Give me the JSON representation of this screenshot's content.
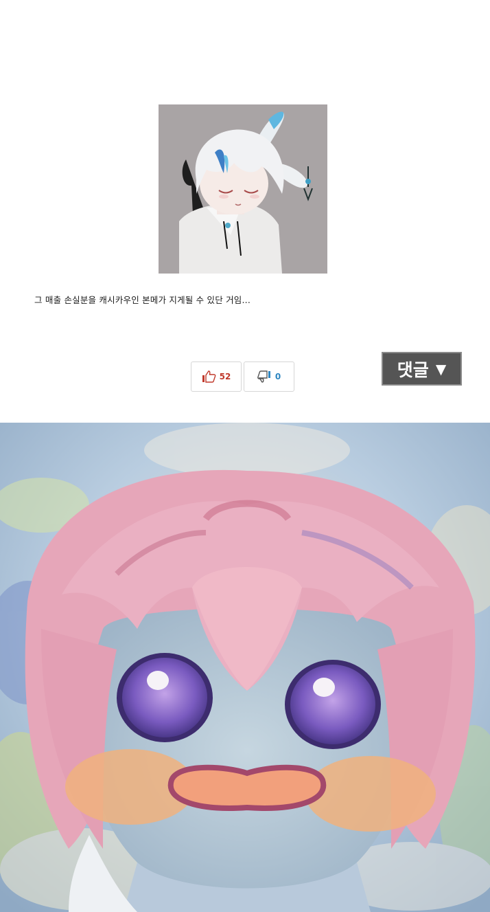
{
  "post": {
    "caption": "그 매출 손실분을 캐시카우인 본메가 지게될 수 있단 거임..."
  },
  "votes": {
    "up_count": "52",
    "down_count": "0",
    "up_icon": "thumbs-up-icon",
    "down_icon": "thumbs-down-icon"
  },
  "comment_toggle": {
    "label": "댓글",
    "arrow": "▼"
  },
  "colors": {
    "up_accent": "#c0392b",
    "down_accent": "#2e86c1",
    "comment_bg": "#555555"
  }
}
